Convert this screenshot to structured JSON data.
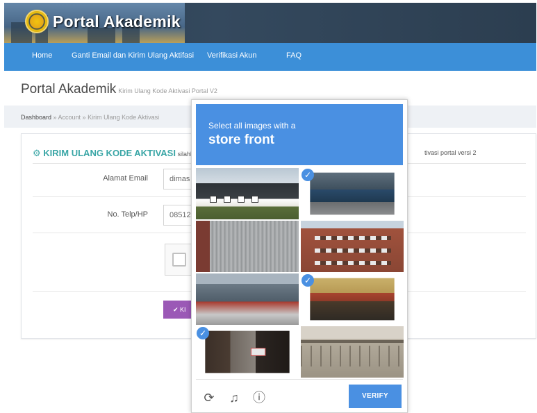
{
  "header": {
    "app_title": "Portal Akademik"
  },
  "nav": {
    "items": [
      {
        "label": "Home"
      },
      {
        "label": "Ganti Email dan Kirim Ulang Aktifasi"
      },
      {
        "label": "Verifikasi Akun"
      },
      {
        "label": "FAQ"
      }
    ]
  },
  "page": {
    "title": "Portal Akademik",
    "subtitle": "Kirim Ulang Kode Aktivasi Portal V2"
  },
  "breadcrumb": {
    "home": "Dashboard",
    "rest": " » Account » Kirim Ulang Kode Aktivasi"
  },
  "form": {
    "heading": "KIRIM ULANG KODE AKTIVASI",
    "heading_note": " silahka",
    "heading_note_right": "tivasi portal versi 2",
    "email_label": "Alamat Email",
    "email_value": "dimas",
    "phone_label": "No. Telp/HP",
    "phone_value": "08512",
    "submit_label": "✔ KI"
  },
  "captcha": {
    "instruction": "Select all images with a",
    "target": "store front",
    "verify_label": "VERIFY",
    "icons": [
      "reload-icon",
      "audio-icon",
      "info-icon"
    ],
    "tiles": [
      {
        "name": "house-roof",
        "selected": false
      },
      {
        "name": "storefront-1",
        "selected": true
      },
      {
        "name": "metal-garage-door",
        "selected": false
      },
      {
        "name": "apartment-building",
        "selected": false
      },
      {
        "name": "street-building",
        "selected": false
      },
      {
        "name": "storefront-2",
        "selected": true
      },
      {
        "name": "storefront-3",
        "selected": true
      },
      {
        "name": "bridge-railing",
        "selected": false
      }
    ],
    "accent": "#4a90e2"
  },
  "colors": {
    "navbar": "#3c8fd8",
    "heading_accent": "#3aa6a6",
    "submit": "#9b59b6"
  }
}
